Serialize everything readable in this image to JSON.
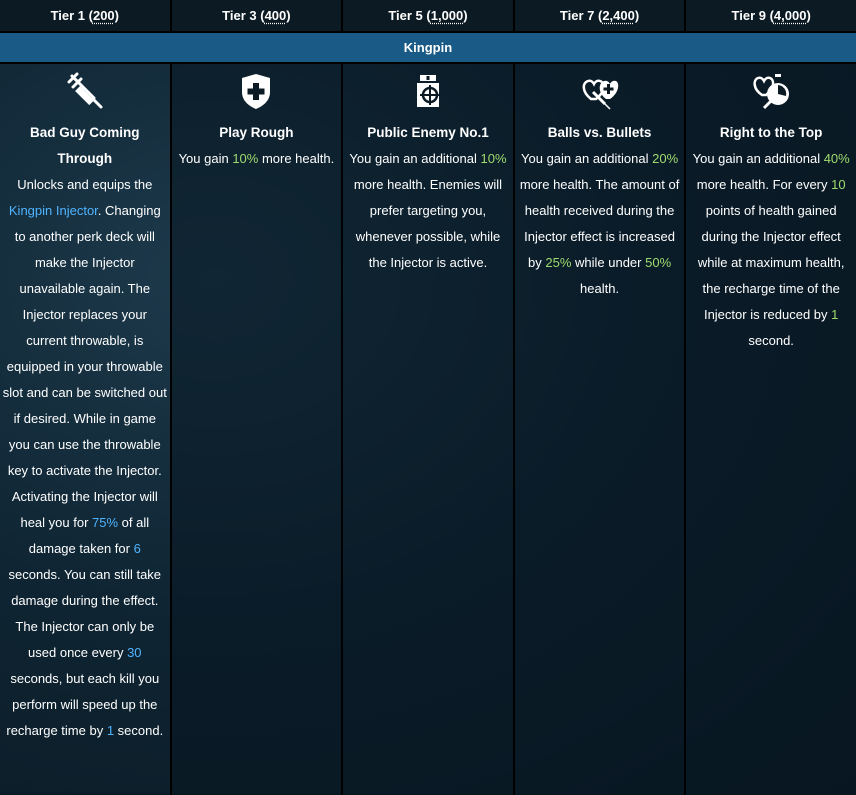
{
  "tiers": [
    {
      "label": "Tier 1",
      "cost": "200"
    },
    {
      "label": "Tier 3",
      "cost": "400"
    },
    {
      "label": "Tier 5",
      "cost": "1,000"
    },
    {
      "label": "Tier 7",
      "cost": "2,400"
    },
    {
      "label": "Tier 9",
      "cost": "4,000"
    }
  ],
  "deck": {
    "name": "Kingpin"
  },
  "perks": {
    "p1": {
      "icon": "syringe-icon",
      "title": "Bad Guy Coming Through",
      "d1": "Unlocks and equips the ",
      "link": "Kingpin Injector",
      "d2": ". Changing to another perk deck will make the Injector unavailable again. The Injector replaces your current throwable, is equipped in your throwable slot and can be switched out if desired. While in game you can use the throwable key to activate the Injector. Activating the Injector will heal you for ",
      "v1": "75%",
      "d3": " of all damage taken for ",
      "v2": "6",
      "d4": " seconds. You can still take damage during the effect. The Injector can only be used once every ",
      "v3": "30",
      "d5": " seconds, but each kill you perform will speed up the recharge time by ",
      "v4": "1",
      "d6": " second."
    },
    "p3": {
      "icon": "shield-cross-icon",
      "title": "Play Rough",
      "d1": "You gain ",
      "v1": "10%",
      "d2": " more health."
    },
    "p5": {
      "icon": "medic-target-icon",
      "title": "Public Enemy No.1",
      "d1": "You gain an additional ",
      "v1": "10%",
      "d2": " more health. Enemies will prefer targeting you, whenever possible, while the Injector is active."
    },
    "p7": {
      "icon": "hearts-syringe-icon",
      "title": "Balls vs. Bullets",
      "d1": "You gain an additional ",
      "v1": "20%",
      "d2": " more health. The amount of health received during the Injector effect is increased by ",
      "v2": "25%",
      "d3": " while under ",
      "v3": "50%",
      "d4": " health."
    },
    "p9": {
      "icon": "heart-stopwatch-icon",
      "title": "Right to the Top",
      "d1": "You gain an additional ",
      "v1": "40%",
      "d2": " more health. For every ",
      "v2": "10",
      "d3": " points of health gained during the Injector effect while at maximum health, the recharge time of the Injector is reduced by ",
      "v3": "1",
      "d4": " second."
    }
  }
}
